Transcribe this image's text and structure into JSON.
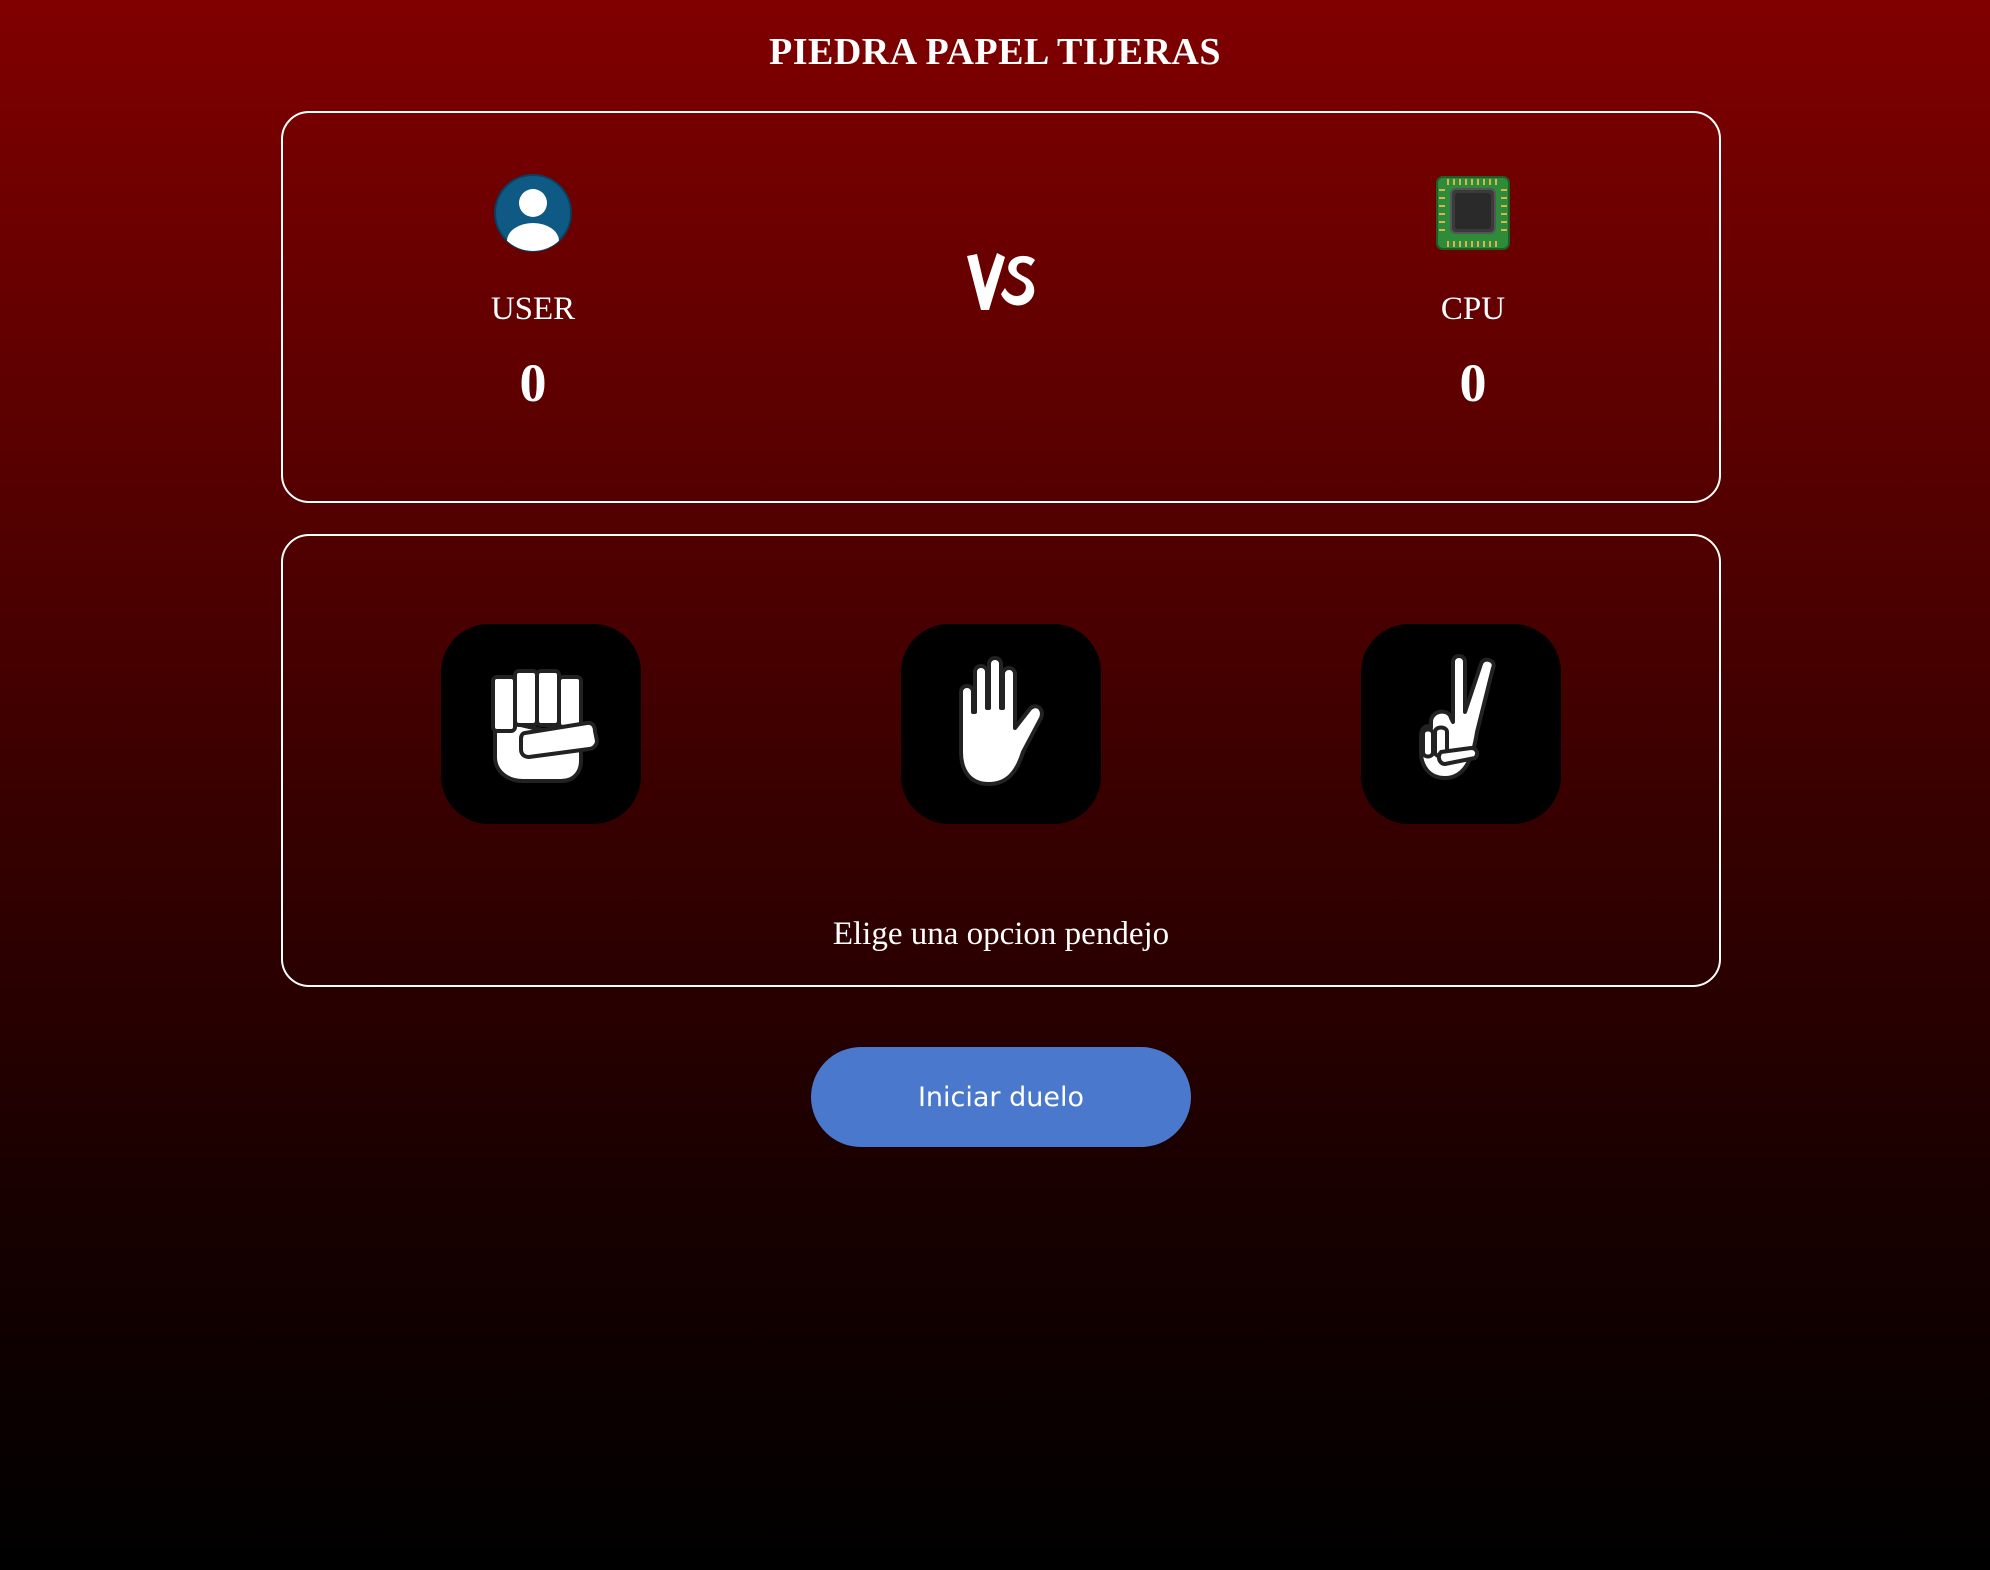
{
  "title": "PIEDRA PAPEL TIJERAS",
  "scoreboard": {
    "user": {
      "name": "USER",
      "score": "0",
      "icon": "user-avatar-icon"
    },
    "vs_label": "VS",
    "cpu": {
      "name": "CPU",
      "score": "0",
      "icon": "cpu-chip-icon"
    }
  },
  "choices": [
    {
      "id": "rock",
      "icon": "fist-icon"
    },
    {
      "id": "paper",
      "icon": "open-hand-icon"
    },
    {
      "id": "scissors",
      "icon": "peace-hand-icon"
    }
  ],
  "prompt": "Elige una opcion pendejo",
  "start_button": {
    "label": "Iniciar duelo"
  },
  "colors": {
    "background_top": "#800000",
    "background_bottom": "#000000",
    "button": "#4a78cc",
    "avatar": "#0f5a84",
    "cpu_board": "#2e8b3a"
  }
}
